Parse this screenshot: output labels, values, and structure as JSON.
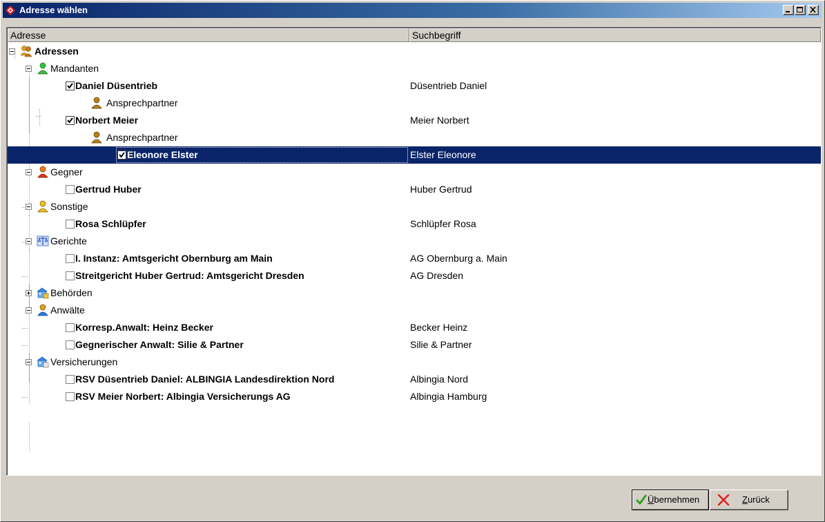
{
  "window": {
    "title": "Adresse wählen"
  },
  "columns": [
    "Adresse",
    "Suchbegriff"
  ],
  "tree": [
    {
      "level": 0,
      "label": "Adressen",
      "bold": true,
      "expander": "minus",
      "icon": "group-people-icon",
      "search": ""
    },
    {
      "level": 1,
      "label": "Mandanten",
      "bold": false,
      "expander": "minus",
      "icon": "person-green-icon",
      "search": ""
    },
    {
      "level": 2,
      "label": "Daniel Düsentrieb",
      "bold": true,
      "checked": true,
      "search": "Düsentrieb Daniel"
    },
    {
      "level": 3,
      "label": "Ansprechpartner",
      "bold": false,
      "icon": "person-brown-icon",
      "search": ""
    },
    {
      "level": 2,
      "label": "Norbert Meier",
      "bold": true,
      "checked": true,
      "search": "Meier Norbert"
    },
    {
      "level": 3,
      "label": "Ansprechpartner",
      "bold": false,
      "icon": "person-brown-icon",
      "search": ""
    },
    {
      "level": 4,
      "label": "Eleonore Elster",
      "bold": true,
      "checked": true,
      "search": "Elster Eleonore",
      "selected": true
    },
    {
      "level": 1,
      "label": "Gegner",
      "bold": false,
      "expander": "minus",
      "icon": "person-red-icon",
      "search": ""
    },
    {
      "level": 2,
      "label": "Gertrud Huber",
      "bold": true,
      "checked": false,
      "search": "Huber Gertrud"
    },
    {
      "level": 1,
      "label": "Sonstige",
      "bold": false,
      "expander": "minus",
      "icon": "person-yellow-icon",
      "search": ""
    },
    {
      "level": 2,
      "label": "Rosa Schlüpfer",
      "bold": true,
      "checked": false,
      "search": "Schlüpfer Rosa"
    },
    {
      "level": 1,
      "label": "Gerichte",
      "bold": false,
      "expander": "minus",
      "icon": "scales-icon",
      "search": ""
    },
    {
      "level": 2,
      "label": "I. Instanz: Amtsgericht Obernburg am Main",
      "bold": true,
      "checked": false,
      "search": "AG Obernburg a. Main"
    },
    {
      "level": 2,
      "label": "Streitgericht Huber Gertrud: Amtsgericht Dresden",
      "bold": true,
      "checked": false,
      "search": "AG Dresden"
    },
    {
      "level": 1,
      "label": "Behörden",
      "bold": false,
      "expander": "plus",
      "icon": "building-icon",
      "search": ""
    },
    {
      "level": 1,
      "label": "Anwälte",
      "bold": false,
      "expander": "minus",
      "icon": "person-blue-icon",
      "search": ""
    },
    {
      "level": 2,
      "label": "Korresp.Anwalt: Heinz Becker",
      "bold": true,
      "checked": false,
      "search": "Becker Heinz"
    },
    {
      "level": 2,
      "label": "Gegnerischer Anwalt: Silie & Partner",
      "bold": true,
      "checked": false,
      "search": "Silie & Partner"
    },
    {
      "level": 1,
      "label": "Versicherungen",
      "bold": false,
      "expander": "minus",
      "icon": "building-icon",
      "search": ""
    },
    {
      "level": 2,
      "label": "RSV Düsentrieb Daniel: ALBINGIA Landesdirektion Nord",
      "bold": true,
      "checked": false,
      "search": "Albingia Nord"
    },
    {
      "level": 2,
      "label": "RSV Meier Norbert: Albingia Versicherungs AG",
      "bold": true,
      "checked": false,
      "search": "Albingia Hamburg"
    }
  ],
  "buttons": {
    "ok_label_prefix": "",
    "ok_label_accel": "Ü",
    "ok_label_rest": "bernehmen",
    "back_label_accel": "Z",
    "back_label_rest": "urück"
  },
  "colors": {
    "titlebar": "#0a246a",
    "selection": "#0a246a",
    "face": "#d4d0c8"
  }
}
